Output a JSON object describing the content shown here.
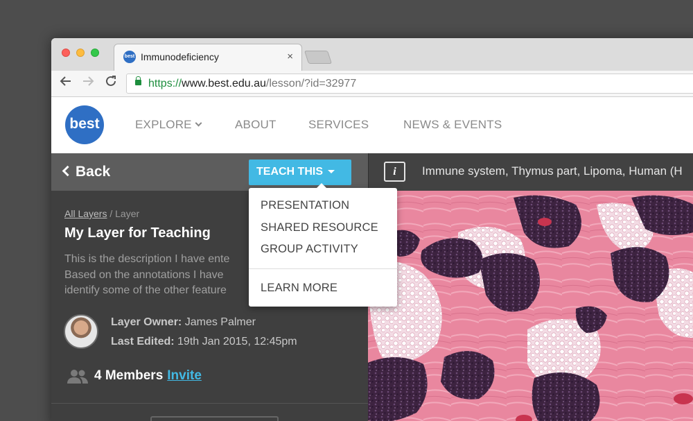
{
  "browser": {
    "tab_title": "Immunodeficiency",
    "tab_favicon_text": "best",
    "tab_close": "×",
    "url_scheme": "https://",
    "url_host": "www.best.edu.au",
    "url_path": "/lesson/?id=32977"
  },
  "site": {
    "logo_text": "best",
    "nav": {
      "explore": "EXPLORE",
      "about": "ABOUT",
      "services": "SERVICES",
      "news": "NEWS & EVENTS"
    }
  },
  "panel": {
    "back_label": "Back",
    "teach_label": "TEACH THIS",
    "breadcrumb_link": "All Layers",
    "breadcrumb_sep": " / ",
    "breadcrumb_current": "Layer",
    "layer_title": "My Layer for Teaching",
    "description_lines": [
      "This is the description I have ente",
      "Based on the annotations I have",
      "identify some of the other feature"
    ],
    "owner_label": "Layer Owner:",
    "owner_name": "James Palmer",
    "edited_label": "Last Edited:",
    "edited_value": "19th Jan 2015, 12:45pm",
    "members_label": "4 Members",
    "invite_label": "Invite"
  },
  "dropdown": {
    "items": [
      "PRESENTATION",
      "SHARED RESOURCE",
      "GROUP ACTIVITY",
      "LEARN MORE"
    ]
  },
  "viewer": {
    "info_label": "i",
    "slide_title": "Immune system, Thymus part, Lipoma, Human (H"
  },
  "colors": {
    "accent": "#42b9e4",
    "brand_blue": "#2f6fc4",
    "panel_dark": "#3f3f3f",
    "tissue_pink": "#e9879f",
    "tissue_purple": "#3d2340"
  }
}
